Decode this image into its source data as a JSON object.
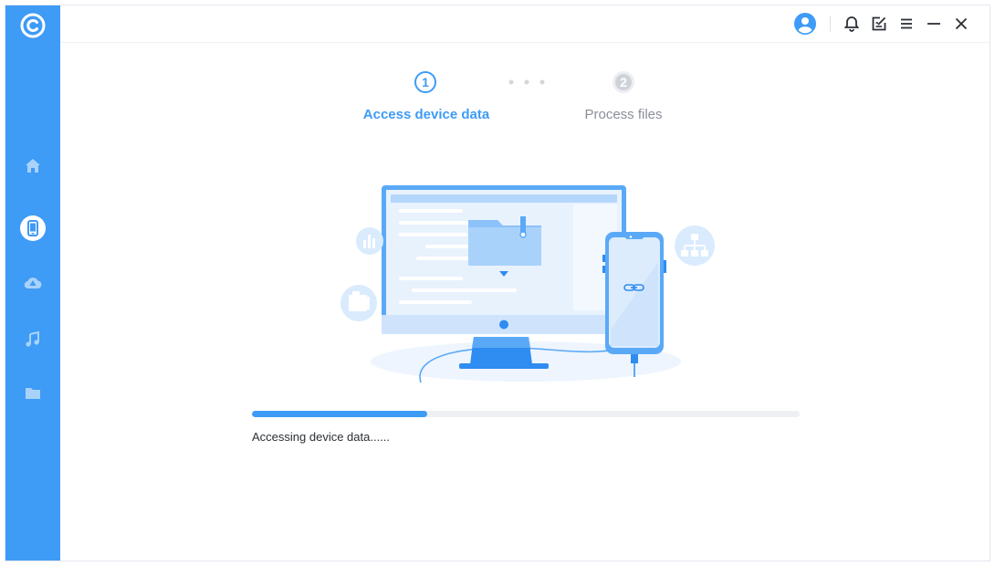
{
  "app": {
    "sidebar": {
      "items": [
        {
          "id": "home",
          "icon": "home-icon",
          "active": false
        },
        {
          "id": "device",
          "icon": "phone-icon",
          "active": true
        },
        {
          "id": "cloud",
          "icon": "cloud-icon",
          "active": false
        },
        {
          "id": "music",
          "icon": "music-icon",
          "active": false
        },
        {
          "id": "files",
          "icon": "folder-icon",
          "active": false
        }
      ]
    },
    "titlebar": {
      "icons": [
        "user-account-icon",
        "bell-icon",
        "feedback-icon",
        "menu-icon",
        "minimize-icon",
        "close-icon"
      ]
    }
  },
  "steps": [
    {
      "number": "1",
      "label": "Access device data",
      "state": "active"
    },
    {
      "number": "2",
      "label": "Process files",
      "state": "pending"
    }
  ],
  "progress": {
    "fraction": 0.32,
    "status": "Accessing device data......"
  },
  "colors": {
    "accent": "#3e9bf6",
    "inactive_step": "#cfd3d9",
    "text": "#2b2f36",
    "muted": "#8a8f98"
  }
}
